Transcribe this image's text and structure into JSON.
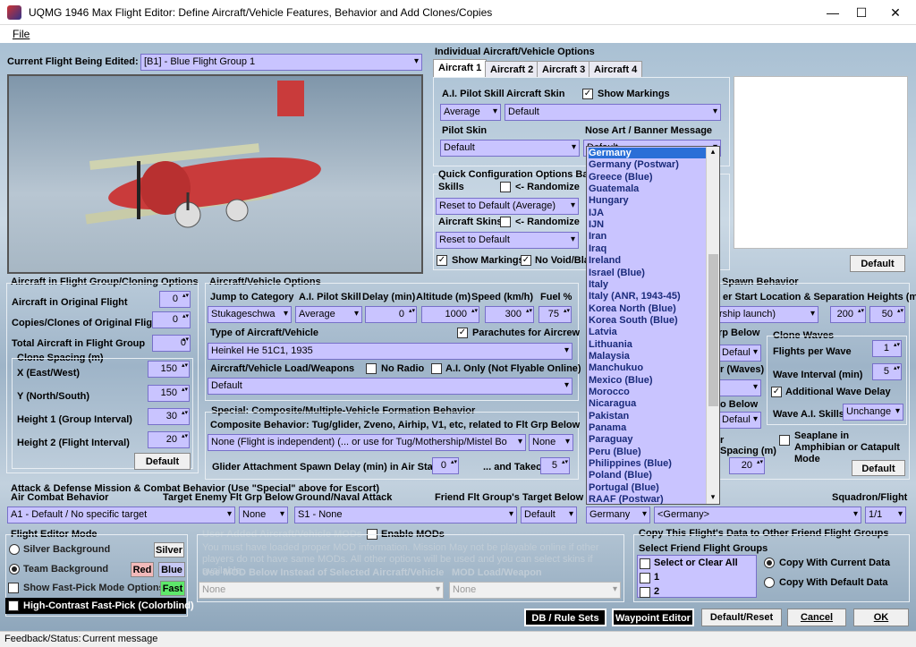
{
  "window": {
    "title": "UQMG 1946 Max Flight Editor:  Define Aircraft/Vehicle Features, Behavior and Add Clones/Copies",
    "min": "—",
    "max": "☐",
    "close": "✕"
  },
  "menu": {
    "file": "File"
  },
  "flight": {
    "label": "Current Flight Being Edited:",
    "value": "[B1] - Blue Flight Group  1"
  },
  "indiv": {
    "title": "Individual Aircraft/Vehicle Options",
    "tabs": [
      "Aircraft 1",
      "Aircraft 2",
      "Aircraft 3",
      "Aircraft 4"
    ],
    "pilot_skill_label": "A.I. Pilot Skill",
    "pilot_skill": "Average",
    "skin_label": "Aircraft Skin",
    "skin": "Default",
    "show_markings": "Show Markings",
    "pilot_skin_label": "Pilot Skin",
    "pilot_skin": "Default",
    "nose_art_label": "Nose Art / Banner Message",
    "nose_art": "Default",
    "default_btn": "Default"
  },
  "quick": {
    "title": "Quick Configuration Options Base",
    "skills_label": "Skills",
    "randomize": "<- Randomize",
    "skills_value": "Reset to Default (Average)",
    "skins_label": "Aircraft Skins",
    "skins_value": "Reset to Default",
    "show_markings": "Show Markings",
    "no_void": "No Void/Bla"
  },
  "dropdown": {
    "items": [
      "Germany",
      "Germany (Postwar)",
      "Greece (Blue)",
      "Guatemala",
      "Hungary",
      "IJA",
      "IJN",
      "Iran",
      "Iraq",
      "Ireland",
      "Israel (Blue)",
      "Italy",
      "Italy (ANR, 1943-45)",
      "Korea North (Blue)",
      "Korea South (Blue)",
      "Latvia",
      "Lithuania",
      "Malaysia",
      "Manchukuo",
      "Mexico (Blue)",
      "Morocco",
      "Nicaragua",
      "Pakistan",
      "Panama",
      "Paraguay",
      "Peru (Blue)",
      "Philippines (Blue)",
      "Poland (Blue)",
      "Portugal (Blue)",
      "RAAF (Postwar)"
    ]
  },
  "cloning": {
    "title": "Aircraft in Flight Group/Cloning Options",
    "orig_label": "Aircraft in Original Flight",
    "orig": "0",
    "copies_label": "Copies/Clones of Original Flight",
    "copies": "0",
    "total_label": "Total Aircraft in Flight Group",
    "total": "0",
    "spacing_title": "Clone Spacing (m)",
    "x_label": "X (East/West)",
    "x": "150",
    "y_label": "Y (North/South)",
    "y": "150",
    "h1_label": "Height 1 (Group Interval)",
    "h1": "30",
    "h2_label": "Height 2 (Flight Interval)",
    "h2": "20",
    "default_btn": "Default"
  },
  "vehicle": {
    "title": "Aircraft/Vehicle Options",
    "jump_label": "Jump to Category",
    "jump": "Stukageschwa",
    "skill_label": "A.I. Pilot Skill",
    "skill": "Average",
    "delay_label": "Delay (min)",
    "delay": "0",
    "alt_label": "Altitude (m)",
    "alt": "1000",
    "speed_label": "Speed (km/h)",
    "speed": "300",
    "fuel_label": "Fuel %",
    "fuel": "75",
    "type_label": "Type of Aircraft/Vehicle",
    "type": "Heinkel He 51C1, 1935",
    "parachutes": "Parachutes for Aircrew",
    "load_label": "Aircraft/Vehicle Load/Weapons",
    "no_radio": "No Radio",
    "ai_only": "A.I. Only (Not Flyable Online)",
    "load": "Default"
  },
  "composite": {
    "title": "Special: Composite/Multiple-Vehicle Formation Behavior",
    "label": "Composite Behavior: Tug/glider, Zveno, Airhip, V1, etc, related to Flt Grp Below",
    "value": "None (Flight is independent) (... or use for Tug/Mothership/Mistel Bo",
    "value2": "None",
    "glider_label": "Glider Attachment Spawn Delay (min) in Air Start",
    "glider": "0",
    "takeoff_label": "... and Takeoff",
    "takeoff": "5"
  },
  "spawn": {
    "title": "Spawn Behavior",
    "start_label": "er Start Location & Separation Heights (m)",
    "start": "rship launch)",
    "h1": "200",
    "h2": "50",
    "grp_below": "rp Below",
    "waves_lbl": "r (Waves)",
    "default1": "Defaul",
    "default2": "Defaul",
    "below": "o Below",
    "sp_label": "r",
    "spacing_label": "Spacing (m)",
    "spacing": "20",
    "clone_waves": "Clone Waves",
    "fpw_label": "Flights per Wave",
    "fpw": "1",
    "wi_label": "Wave Interval (min)",
    "wi": "5",
    "additional": "Additional Wave Delay",
    "wave_skill_label": "Wave A.I. Skills",
    "wave_skill": "Unchange",
    "seaplane": "Seaplane in Amphibian or Catapult Mode",
    "default_btn": "Default"
  },
  "attack": {
    "title": "Attack & Defense Mission & Combat Behavior (Use \"Special\" above for Escort)",
    "air_label": "Air Combat Behavior",
    "air": "A1 - Default / No specific target",
    "target_label": "Target Enemy Flt Grp Below",
    "target": "None",
    "ground_label": "Ground/Naval Attack",
    "ground": "S1 - None",
    "friend_label": "Friend Flt Group's Target Below",
    "friend": "Default",
    "country": "Germany",
    "country2": "<Germany>",
    "squadron_label": "Squadron/Flight",
    "squadron": "1/1"
  },
  "mode": {
    "title": "Flight Editor Mode",
    "silver": "Silver Background",
    "silver_btn": "Silver",
    "team": "Team Background",
    "red": "Red",
    "blue": "Blue",
    "fast": "Show Fast-Pick Mode Options",
    "fast_btn": "Fast",
    "contrast": "High-Contrast Fast-Pick (Colorblind)"
  },
  "mods": {
    "title": "User Added Aircraft/Vehicle MODs",
    "enable": "Enable MODs",
    "note": "You must have loaded proper MOD information. Mission May not be playable online if other players do not have same MODs. All other options will be used and you can select skins if available.",
    "opt1": "Use MOD Below Instead of Selected Aircraft/Vehicle",
    "opt2": "MOD Load/Weapon",
    "sel1": "None",
    "sel2": "None"
  },
  "copy": {
    "title": "Copy This Flight's Data to Other Friend Flight Groups",
    "select_label": "Select Friend Flight Groups",
    "items": [
      "Select or Clear All",
      "1",
      "2"
    ],
    "current": "Copy With Current Data",
    "default": "Copy With Default Data"
  },
  "buttons": {
    "db": "DB / Rule Sets",
    "waypoint": "Waypoint Editor",
    "default_reset": "Default/Reset",
    "cancel": "Cancel",
    "ok": "OK"
  },
  "status": {
    "label": "Feedback/Status:",
    "message": "Current message"
  }
}
